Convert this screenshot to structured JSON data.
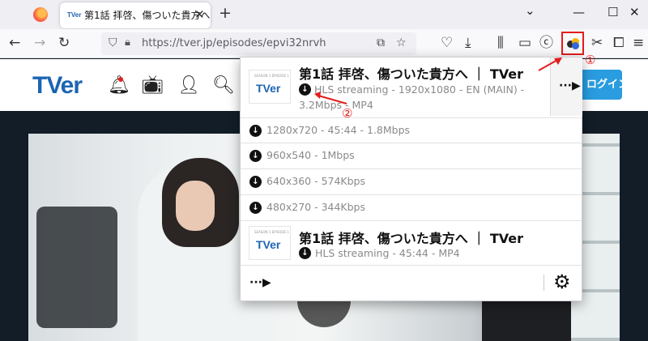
{
  "browser": {
    "tab": {
      "favicon_text": "TVer",
      "title": "第1話 拝啓、傷ついた貴方へ",
      "close_glyph": "✕"
    },
    "new_tab_glyph": "+",
    "window": {
      "dropdown": "⌄",
      "minimize": "—",
      "maximize": "☐",
      "close": "✕"
    },
    "url": "https://tver.jp/episodes/epvi32nrvh"
  },
  "site": {
    "logo": "TVer",
    "login_button": "ログイン"
  },
  "popup": {
    "main_item": {
      "thumb_logo": "TVer",
      "thumb_caption": "SEASON 1 EPISODE 1",
      "title": "第1話 拝啓、傷ついた貴方へ ｜ TVer",
      "subtitle": "HLS streaming - 1920x1080 - EN (MAIN) - 3.2Mbps - MP4"
    },
    "variants": [
      {
        "label": "1280x720 - 45:44 - 1.8Mbps"
      },
      {
        "label": "960x540 - 1Mbps"
      },
      {
        "label": "640x360 - 574Kbps"
      },
      {
        "label": "480x270 - 344Kbps"
      }
    ],
    "second_item": {
      "thumb_logo": "TVer",
      "thumb_caption": "SEASON 1 EPISODE 1",
      "title": "第1話 拝啓、傷ついた貴方へ ｜ TVer",
      "subtitle": "HLS streaming - 45:44 - MP4"
    },
    "more_glyph": "···▶",
    "icons": {
      "download": "download-icon",
      "settings": "gear-icon"
    }
  },
  "annotations": {
    "step1": "①",
    "step2": "②",
    "color": "#e31c1c"
  }
}
